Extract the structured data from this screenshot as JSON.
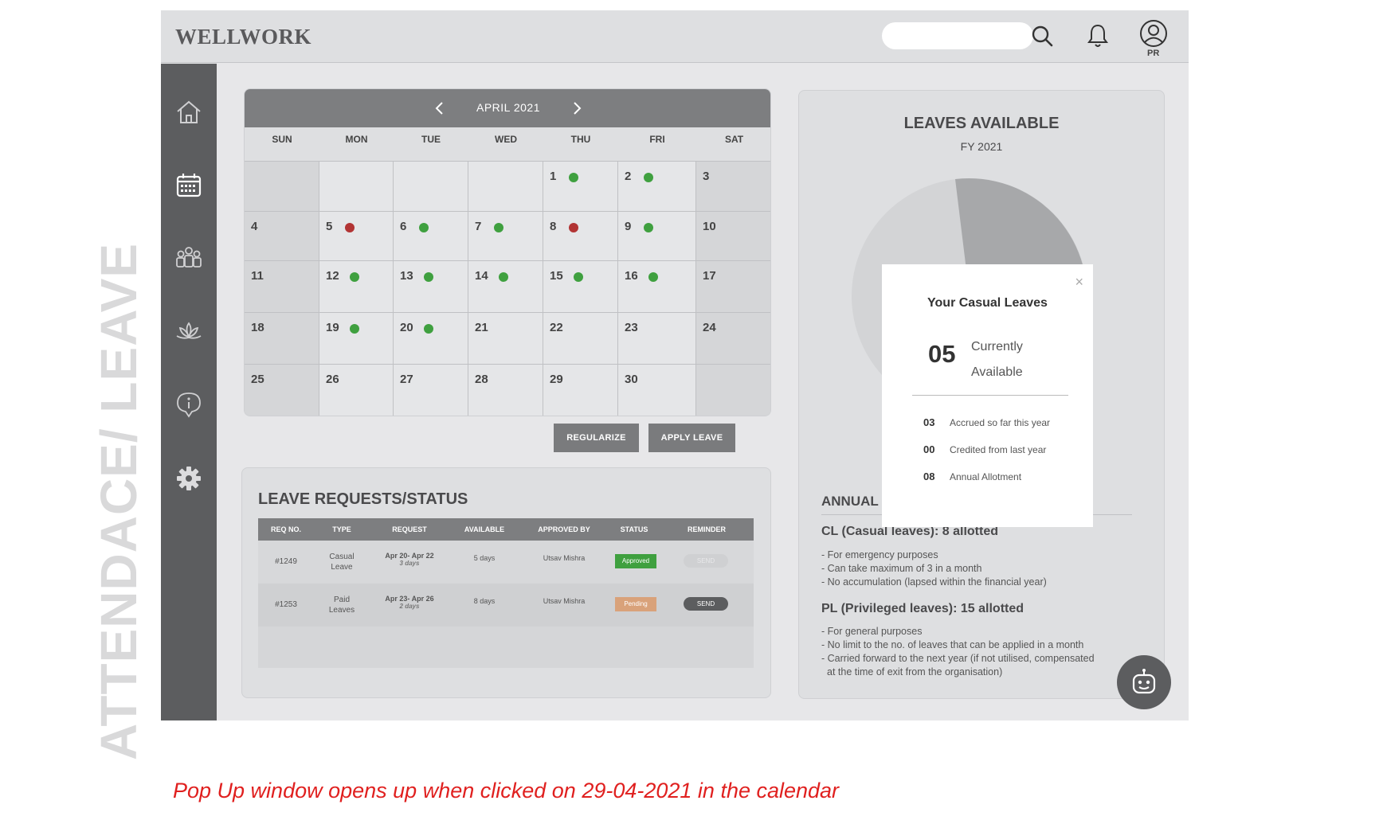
{
  "page_label": "ATTENDACE/ LEAVE",
  "header": {
    "logo": "WELLWORK",
    "search_placeholder": "",
    "avatar_initials": "PR"
  },
  "sidebar": {
    "items": [
      {
        "name": "home-icon"
      },
      {
        "name": "calendar-icon"
      },
      {
        "name": "team-icon"
      },
      {
        "name": "lotus-icon"
      },
      {
        "name": "info-icon"
      },
      {
        "name": "settings-icon"
      }
    ]
  },
  "calendar": {
    "month": "APRIL 2021",
    "days_of_week": [
      "SUN",
      "MON",
      "TUE",
      "WED",
      "THU",
      "FRI",
      "SAT"
    ],
    "colors": {
      "present": "#3fa03f",
      "absent": "#b23434"
    },
    "weeks": [
      [
        null,
        null,
        null,
        null,
        {
          "d": "1",
          "dot": "present"
        },
        {
          "d": "2",
          "dot": "present"
        },
        {
          "d": "3"
        }
      ],
      [
        {
          "d": "4"
        },
        {
          "d": "5",
          "dot": "absent"
        },
        {
          "d": "6",
          "dot": "present"
        },
        {
          "d": "7",
          "dot": "present"
        },
        {
          "d": "8",
          "dot": "absent"
        },
        {
          "d": "9",
          "dot": "present"
        },
        {
          "d": "10"
        }
      ],
      [
        {
          "d": "11"
        },
        {
          "d": "12",
          "dot": "present"
        },
        {
          "d": "13",
          "dot": "present"
        },
        {
          "d": "14",
          "dot": "present"
        },
        {
          "d": "15",
          "dot": "present"
        },
        {
          "d": "16",
          "dot": "present"
        },
        {
          "d": "17"
        }
      ],
      [
        {
          "d": "18"
        },
        {
          "d": "19",
          "dot": "present"
        },
        {
          "d": "20",
          "dot": "present"
        },
        {
          "d": "21"
        },
        {
          "d": "22"
        },
        {
          "d": "23"
        },
        {
          "d": "24"
        }
      ],
      [
        {
          "d": "25"
        },
        {
          "d": "26"
        },
        {
          "d": "27"
        },
        {
          "d": "28"
        },
        {
          "d": "29"
        },
        {
          "d": "30"
        },
        null
      ]
    ],
    "buttons": {
      "regularize": "REGULARIZE",
      "apply": "APPLY LEAVE"
    }
  },
  "requests": {
    "title": "LEAVE REQUESTS/STATUS",
    "columns": [
      "REQ NO.",
      "TYPE",
      "REQUEST",
      "AVAILABLE",
      "APPROVED BY",
      "STATUS",
      "REMINDER"
    ],
    "rows": [
      {
        "req_no": "#1249",
        "type": "Casual Leave",
        "request": "Apr 20- Apr 22",
        "request_days": "3 days",
        "available": "5 days",
        "approved_by": "Utsav Mishra",
        "status": "Approved",
        "status_color": "#3fa03f",
        "reminder": "SEND",
        "reminder_enabled": false
      },
      {
        "req_no": "#1253",
        "type": "Paid Leaves",
        "request": "Apr 23- Apr 26",
        "request_days": "2 days",
        "available": "8 days",
        "approved_by": "Utsav Mishra",
        "status": "Pending",
        "status_color": "#d9a27a",
        "reminder": "SEND",
        "reminder_enabled": true
      }
    ]
  },
  "leaves": {
    "title": "LEAVES AVAILABLE",
    "subtitle": "FY 2021",
    "annual_heading": "ANNUAL",
    "cl_heading": "CL (Casual leaves): 8 allotted",
    "cl_lines": [
      "- For emergency purposes",
      "- Can take maximum of 3 in a month",
      "- No accumulation (lapsed within the financial year)"
    ],
    "pl_heading": "PL (Privileged leaves): 15 allotted",
    "pl_lines": [
      "- For general purposes",
      "- No limit to the no. of leaves that can be applied in a month",
      "- Carried forward to the next year (if not utilised, compensated",
      "  at the time of exit from the organisation)"
    ]
  },
  "popup": {
    "title": "Your Casual Leaves",
    "big_number": "05",
    "big_label_1": "Currently",
    "big_label_2": "Available",
    "rows": [
      {
        "num": "03",
        "label": "Accrued so far this year"
      },
      {
        "num": "00",
        "label": "Credited from last year"
      },
      {
        "num": "08",
        "label": "Annual Allotment"
      }
    ],
    "close": "×"
  },
  "caption": "Pop Up window opens up when clicked on 29-04-2021 in the calendar"
}
